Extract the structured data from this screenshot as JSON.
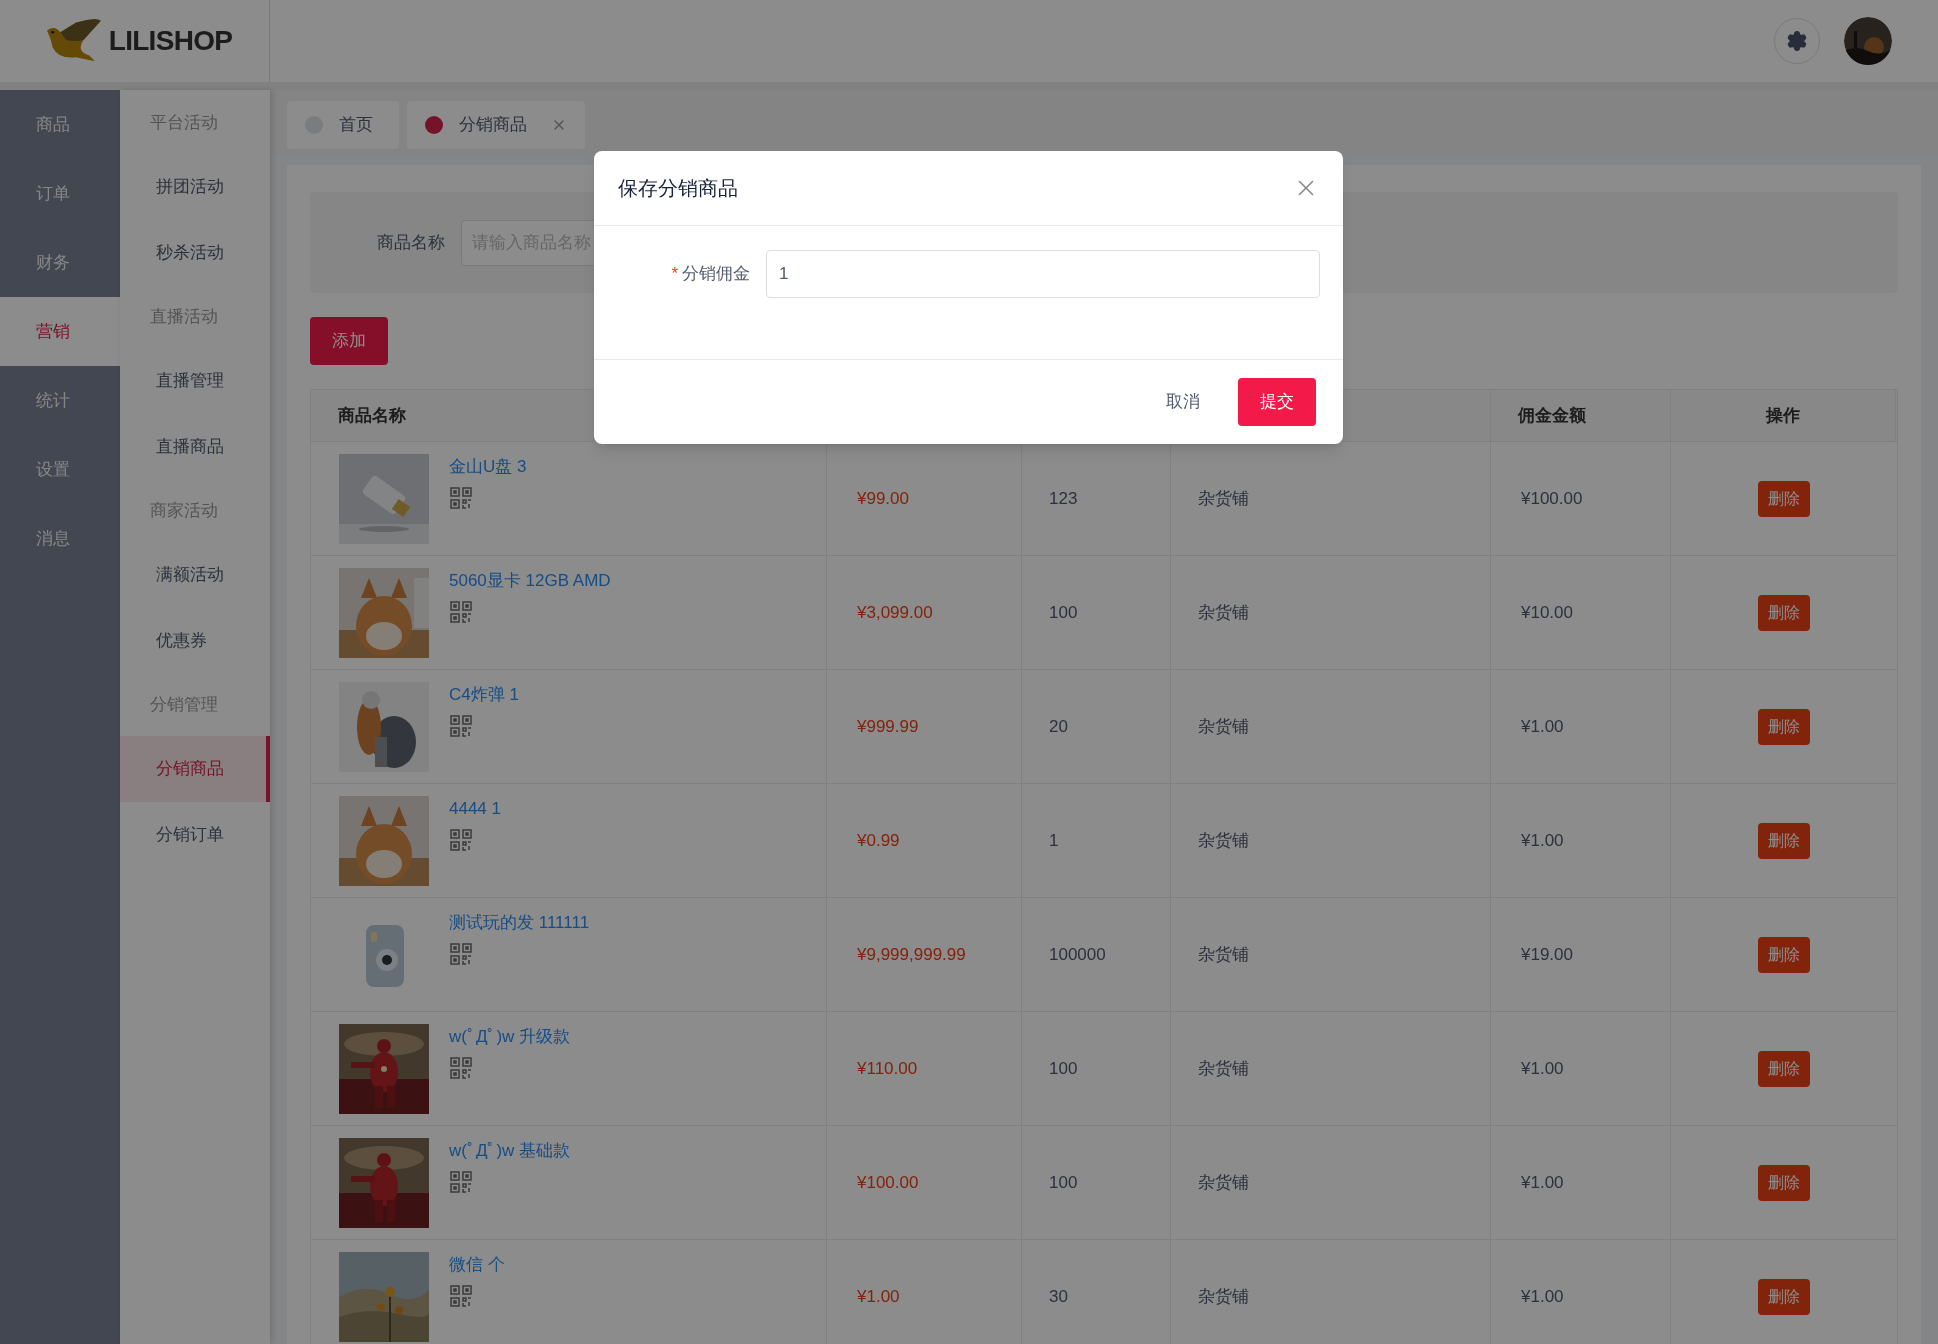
{
  "logo": {
    "text": "LILISHOP"
  },
  "main_menu": [
    {
      "label": "商品",
      "selected": false
    },
    {
      "label": "订单",
      "selected": false
    },
    {
      "label": "财务",
      "selected": false
    },
    {
      "label": "营销",
      "selected": true
    },
    {
      "label": "统计",
      "selected": false
    },
    {
      "label": "设置",
      "selected": false
    },
    {
      "label": "消息",
      "selected": false
    }
  ],
  "sub_menu": [
    {
      "label": "平台活动",
      "kind": "heading",
      "selected": false
    },
    {
      "label": "拼团活动",
      "kind": "item",
      "selected": false
    },
    {
      "label": "秒杀活动",
      "kind": "item",
      "selected": false
    },
    {
      "label": "直播活动",
      "kind": "heading",
      "selected": false
    },
    {
      "label": "直播管理",
      "kind": "item",
      "selected": false
    },
    {
      "label": "直播商品",
      "kind": "item",
      "selected": false
    },
    {
      "label": "商家活动",
      "kind": "heading",
      "selected": false
    },
    {
      "label": "满额活动",
      "kind": "item",
      "selected": false
    },
    {
      "label": "优惠券",
      "kind": "item",
      "selected": false
    },
    {
      "label": "分销管理",
      "kind": "heading",
      "selected": false
    },
    {
      "label": "分销商品",
      "kind": "item",
      "selected": true
    },
    {
      "label": "分销订单",
      "kind": "item",
      "selected": false
    }
  ],
  "tabs": [
    {
      "label": "首页",
      "selected": false,
      "closable": false
    },
    {
      "label": "分销商品",
      "selected": true,
      "closable": true
    }
  ],
  "search": {
    "label": "商品名称",
    "placeholder": "请输入商品名称"
  },
  "add_button": "添加",
  "table": {
    "columns": [
      "商品名称",
      "",
      "",
      "",
      "佣金金额",
      "操作"
    ],
    "rows": [
      {
        "name": "金山U盘 3",
        "price": "¥99.00",
        "stock": "123",
        "store": "杂货铺",
        "commission": "¥100.00",
        "action": "删除"
      },
      {
        "name": "5060显卡 12GB AMD",
        "price": "¥3,099.00",
        "stock": "100",
        "store": "杂货铺",
        "commission": "¥10.00",
        "action": "删除"
      },
      {
        "name": "C4炸弹 1",
        "price": "¥999.99",
        "stock": "20",
        "store": "杂货铺",
        "commission": "¥1.00",
        "action": "删除"
      },
      {
        "name": "4444 1",
        "price": "¥0.99",
        "stock": "1",
        "store": "杂货铺",
        "commission": "¥1.00",
        "action": "删除"
      },
      {
        "name": "测试玩的发 111111",
        "price": "¥9,999,999.99",
        "stock": "100000",
        "store": "杂货铺",
        "commission": "¥19.00",
        "action": "删除"
      },
      {
        "name": "w(ﾟДﾟ)w 升级款",
        "price": "¥110.00",
        "stock": "100",
        "store": "杂货铺",
        "commission": "¥1.00",
        "action": "删除"
      },
      {
        "name": "w(ﾟДﾟ)w 基础款",
        "price": "¥100.00",
        "stock": "100",
        "store": "杂货铺",
        "commission": "¥1.00",
        "action": "删除"
      },
      {
        "name": "微信 个",
        "price": "¥1.00",
        "stock": "30",
        "store": "杂货铺",
        "commission": "¥1.00",
        "action": "删除"
      }
    ]
  },
  "modal": {
    "title": "保存分销商品",
    "field": {
      "required_mark": "*",
      "label": "分销佣金",
      "value": "1"
    },
    "buttons": [
      {
        "label": "取消",
        "kind": "text"
      },
      {
        "label": "提交",
        "kind": "primary"
      }
    ]
  }
}
